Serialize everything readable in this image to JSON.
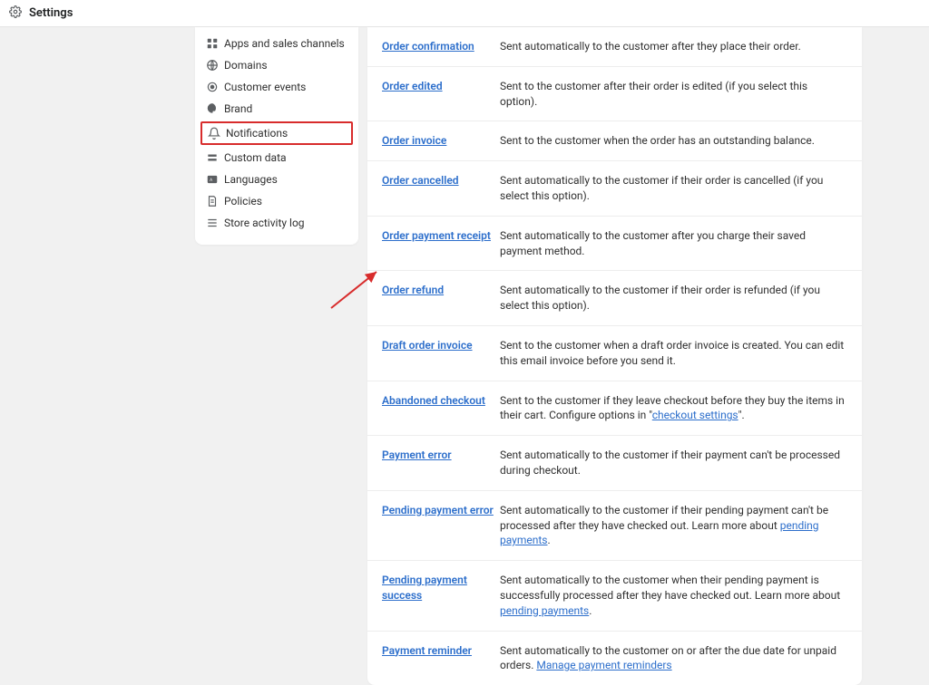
{
  "header": {
    "title": "Settings"
  },
  "sidebar": {
    "items": [
      {
        "label": "Apps and sales channels"
      },
      {
        "label": "Domains"
      },
      {
        "label": "Customer events"
      },
      {
        "label": "Brand"
      },
      {
        "label": "Notifications"
      },
      {
        "label": "Custom data"
      },
      {
        "label": "Languages"
      },
      {
        "label": "Policies"
      },
      {
        "label": "Store activity log"
      }
    ]
  },
  "notifications": [
    {
      "title": "Order confirmation",
      "desc": "Sent automatically to the customer after they place their order."
    },
    {
      "title": "Order edited",
      "desc": "Sent to the customer after their order is edited (if you select this option)."
    },
    {
      "title": "Order invoice",
      "desc": "Sent to the customer when the order has an outstanding balance."
    },
    {
      "title": "Order cancelled",
      "desc": "Sent automatically to the customer if their order is cancelled (if you select this option)."
    },
    {
      "title": "Order payment receipt",
      "desc": "Sent automatically to the customer after you charge their saved payment method."
    },
    {
      "title": "Order refund",
      "desc": "Sent automatically to the customer if their order is refunded (if you select this option)."
    },
    {
      "title": "Draft order invoice",
      "desc": "Sent to the customer when a draft order invoice is created. You can edit this email invoice before you send it."
    },
    {
      "title": "Abandoned checkout",
      "desc_pre": "Sent to the customer if they leave checkout before they buy the items in their cart. Configure options in \"",
      "desc_link": "checkout settings",
      "desc_post": "\"."
    },
    {
      "title": "Payment error",
      "desc": "Sent automatically to the customer if their payment can't be processed during checkout."
    },
    {
      "title": "Pending payment error",
      "desc_pre": "Sent automatically to the customer if their pending payment can't be processed after they have checked out. Learn more about ",
      "desc_link": "pending payments",
      "desc_post": "."
    },
    {
      "title": "Pending payment success",
      "desc_pre": "Sent automatically to the customer when their pending payment is successfully processed after they have checked out. Learn more about ",
      "desc_link": "pending payments",
      "desc_post": "."
    },
    {
      "title": "Payment reminder",
      "desc_pre": "Sent automatically to the customer on or after the due date for unpaid orders. ",
      "desc_link": "Manage payment reminders",
      "desc_post": ""
    }
  ]
}
